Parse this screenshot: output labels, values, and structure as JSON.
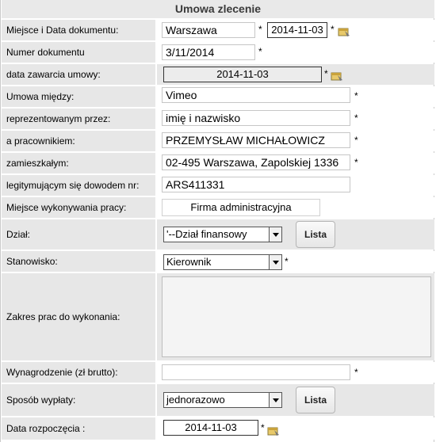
{
  "form": {
    "title": "Umowa zlecenie",
    "required_mark": "*",
    "rows": {
      "place_date": {
        "label": "Miejsce i Data dokumentu:",
        "place": "Warszawa",
        "date": "2014-11-03"
      },
      "doc_number": {
        "label": "Numer dokumentu",
        "value": "3/11/2014"
      },
      "contract_date": {
        "label": "data zawarcia umowy:",
        "value": "2014-11-03"
      },
      "between": {
        "label": "Umowa między:",
        "value": "Vimeo"
      },
      "represented": {
        "label": "reprezentowanym przez:",
        "value": "imię i nazwisko"
      },
      "employee": {
        "label": "a pracownikiem:",
        "value": "PRZEMYSŁAW MICHAŁOWICZ"
      },
      "address": {
        "label": "zamieszkałym:",
        "value": "02-495 Warszawa, Zapolskiej 1336"
      },
      "id_doc": {
        "label": "legitymującym się dowodem nr:",
        "value": "ARS411331"
      },
      "workplace": {
        "label": "Miejsce wykonywania pracy:",
        "value": "Firma administracyjna"
      },
      "department": {
        "label": "Dział:",
        "selected": "'--Dział finansowy",
        "button": "Lista"
      },
      "position": {
        "label": "Stanowisko:",
        "selected": "Kierownik"
      },
      "scope": {
        "label": "Zakres prac do wykonania:",
        "value": ""
      },
      "salary": {
        "label": "Wynagrodzenie (zł brutto):",
        "value": ""
      },
      "payment": {
        "label": "Sposób wypłaty:",
        "selected": "jednorazowo",
        "button": "Lista"
      },
      "start_date": {
        "label": "Data rozpoczęcia :",
        "value": "2014-11-03"
      }
    }
  },
  "icons": {
    "calendar": "calendar-icon"
  }
}
